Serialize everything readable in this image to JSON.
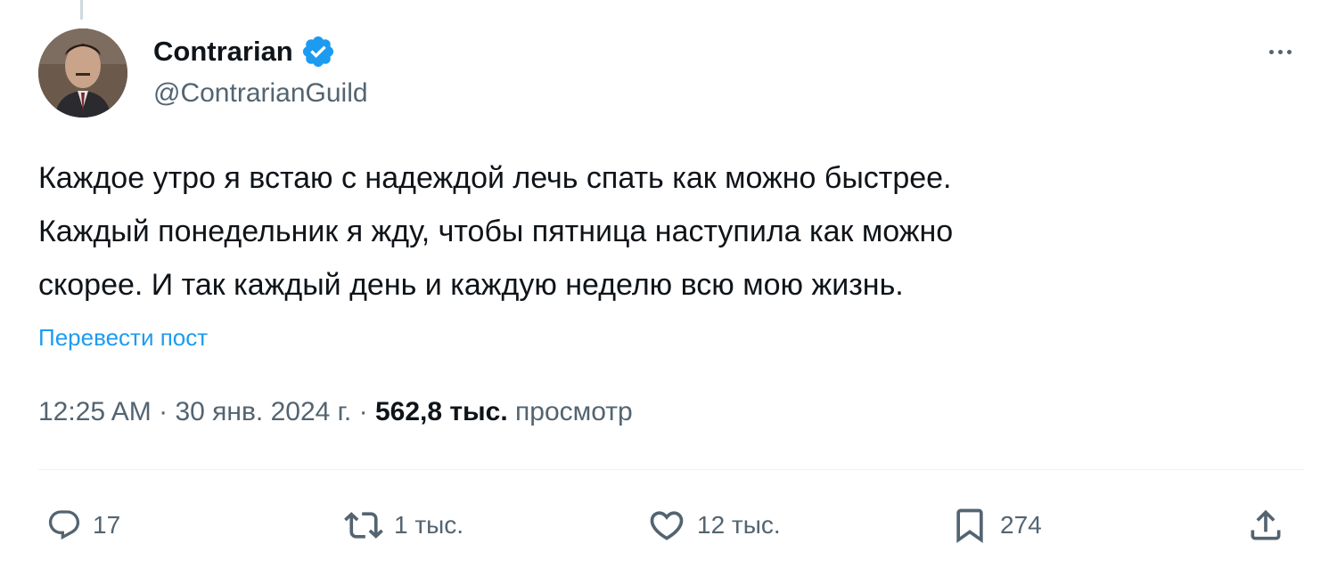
{
  "author": {
    "display_name": "Contrarian",
    "handle": "@ContrarianGuild",
    "verified": true,
    "avatar_icon": "avatar-photo"
  },
  "tweet": {
    "lines": [
      "Каждое утро я встаю с надеждой лечь спать как можно быстрее.",
      "Каждый понедельник я жду, чтобы пятница наступила как можно",
      "скорее. И так каждый день и каждую неделю всю мою жизнь."
    ],
    "translate_label": "Перевести пост"
  },
  "meta": {
    "time": "12:25 AM",
    "separator": "·",
    "date": "30 янв. 2024 г.",
    "views_count": "562,8 тыс.",
    "views_label": "просмотр"
  },
  "actions": {
    "reply": {
      "icon": "reply-icon",
      "count": "17"
    },
    "repost": {
      "icon": "repost-icon",
      "count": "1 тыс."
    },
    "like": {
      "icon": "heart-icon",
      "count": "12 тыс."
    },
    "bookmark": {
      "icon": "bookmark-icon",
      "count": "274"
    },
    "share": {
      "icon": "share-icon"
    }
  },
  "colors": {
    "text_primary": "#0f1419",
    "text_secondary": "#536471",
    "link": "#1d9bf0",
    "verified_badge": "#1d9bf0",
    "divider": "#eff3f4"
  }
}
